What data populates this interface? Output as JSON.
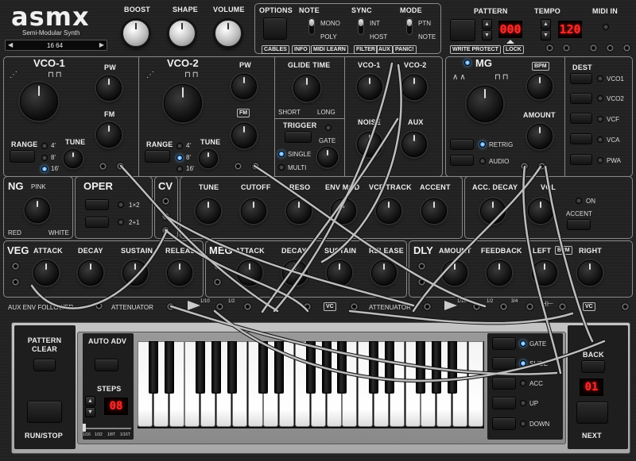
{
  "app": {
    "logo": "asmx",
    "subtitle": "Semi-Modular Synth",
    "preset_display": "16 64"
  },
  "top": {
    "boost": "BOOST",
    "shape": "SHAPE",
    "volume": "VOLUME",
    "options": "OPTIONS",
    "note": "NOTE",
    "note_mono": "MONO",
    "note_poly": "POLY",
    "sync": "SYNC",
    "sync_int": "INT",
    "sync_host": "HOST",
    "mode": "MODE",
    "mode_ptn": "PTN",
    "mode_note": "NOTE",
    "tags": [
      "CABLES",
      "INFO",
      "MIDI LEARN",
      "FILTER",
      "AUX",
      "PANIC!"
    ],
    "pattern": "PATTERN",
    "pattern_value": "000",
    "tempo": "TEMPO",
    "tempo_value": "120",
    "midi_in": "MIDI IN",
    "write_protect": "WRITE PROTECT",
    "lock": "LOCK"
  },
  "vco1": {
    "title": "VCO-1",
    "pw": "PW",
    "fm": "FM",
    "range": "RANGE",
    "tune": "TUNE",
    "ranges": [
      "4'",
      "8'",
      "16'"
    ]
  },
  "vco2": {
    "title": "VCO-2",
    "pw": "PW",
    "fm": "FM",
    "range": "RANGE",
    "tune": "TUNE",
    "ranges": [
      "4'",
      "8'",
      "16'"
    ]
  },
  "glide": {
    "title": "GLIDE TIME",
    "short": "SHORT",
    "long": "LONG",
    "trigger": "TRIGGER",
    "gate": "GATE",
    "single": "SINGLE",
    "multi": "MULTI"
  },
  "mixer": {
    "vco1": "VCO-1",
    "vco2": "VCO-2",
    "noise": "NOISE",
    "aux": "AUX"
  },
  "mg": {
    "title": "MG",
    "bpm": "BPM",
    "amount": "AMOUNT",
    "retrig": "RETRIG",
    "audio": "AUDIO",
    "dest": "DEST",
    "dests": [
      "VCO1",
      "VCO2",
      "VCF",
      "VCA",
      "PWA"
    ]
  },
  "ng": {
    "title": "NG",
    "pink": "PINK",
    "red": "RED",
    "white": "WHITE"
  },
  "oper": {
    "title": "OPER",
    "one_x_two": "1×2",
    "two_plus_one": "2+1"
  },
  "cv": {
    "title": "CV"
  },
  "vcf": {
    "tune": "TUNE",
    "cutoff": "CUTOFF",
    "reso": "RESO",
    "env_mod": "ENV MOD",
    "vcf_track": "VCF TRACK",
    "accent": "ACCENT"
  },
  "acc": {
    "acc_decay": "ACC. DECAY",
    "vol": "VOL",
    "on": "ON",
    "accent": "ACCENT"
  },
  "veg": {
    "title": "VEG",
    "attack": "ATTACK",
    "decay": "DECAY",
    "sustain": "SUSTAIN",
    "release": "RELEASE"
  },
  "meg": {
    "title": "MEG",
    "attack": "ATTACK",
    "decay": "DECAY",
    "sustain": "SUSTAIN",
    "release": "RELEASE"
  },
  "dly": {
    "title": "DLY",
    "amount": "AMOUNT",
    "feedback": "FEEDBACK",
    "left": "LEFT",
    "bpm": "BPM",
    "right": "RIGHT"
  },
  "util": {
    "aux_env_follower": "AUX ENV FOLLOWER",
    "attenuator1": "ATTENUATOR",
    "att1_max": "1/10",
    "att1_half": "1/2",
    "vc1": "VC",
    "attenuator2": "ATTENUATOR",
    "att2_max": "1/10",
    "att2_half": "1/2",
    "att2_34": "3/4",
    "vc2": "VC"
  },
  "seq": {
    "pattern_clear": "PATTERN CLEAR",
    "run_stop": "RUN/STOP",
    "auto_adv": "AUTO ADV",
    "steps": "STEPS",
    "steps_value": "08",
    "step_divs": [
      "1/16",
      "1/32",
      "1/8T",
      "1/16T"
    ],
    "gate": "GATE",
    "slide": "SLIDE",
    "acc": "ACC",
    "up": "UP",
    "down": "DOWN",
    "back": "BACK",
    "step_value": "01",
    "next": "NEXT"
  }
}
